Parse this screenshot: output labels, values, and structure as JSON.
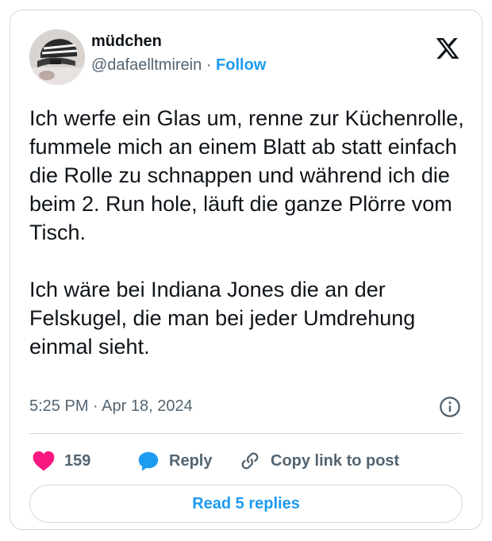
{
  "author": {
    "display_name": "müdchen",
    "handle": "@dafaelltmirein",
    "separator": "·",
    "follow_label": "Follow"
  },
  "tweet": {
    "paragraphs": [
      "Ich werfe ein Glas um, renne zur Küchenrolle, fummele mich an einem Blatt ab statt einfach die Rolle zu schnappen und während ich die beim 2. Run hole, läuft die ganze Plörre vom Tisch.",
      "Ich wäre bei Indiana Jones die an der Felskugel, die man bei jeder Umdrehung einmal sieht."
    ]
  },
  "meta": {
    "time": "5:25 PM",
    "separator": "·",
    "date": "Apr 18, 2024"
  },
  "actions": {
    "like_count": "159",
    "reply_label": "Reply",
    "copy_label": "Copy link to post"
  },
  "footer": {
    "read_replies_label": "Read 5 replies"
  },
  "colors": {
    "accent": "#1d9bf0",
    "like": "#f91880",
    "text": "#0f1419",
    "muted": "#536471",
    "border": "#cfd9de"
  },
  "icons": [
    "x-logo-icon",
    "info-icon",
    "heart-icon",
    "reply-bubble-icon",
    "link-icon"
  ]
}
